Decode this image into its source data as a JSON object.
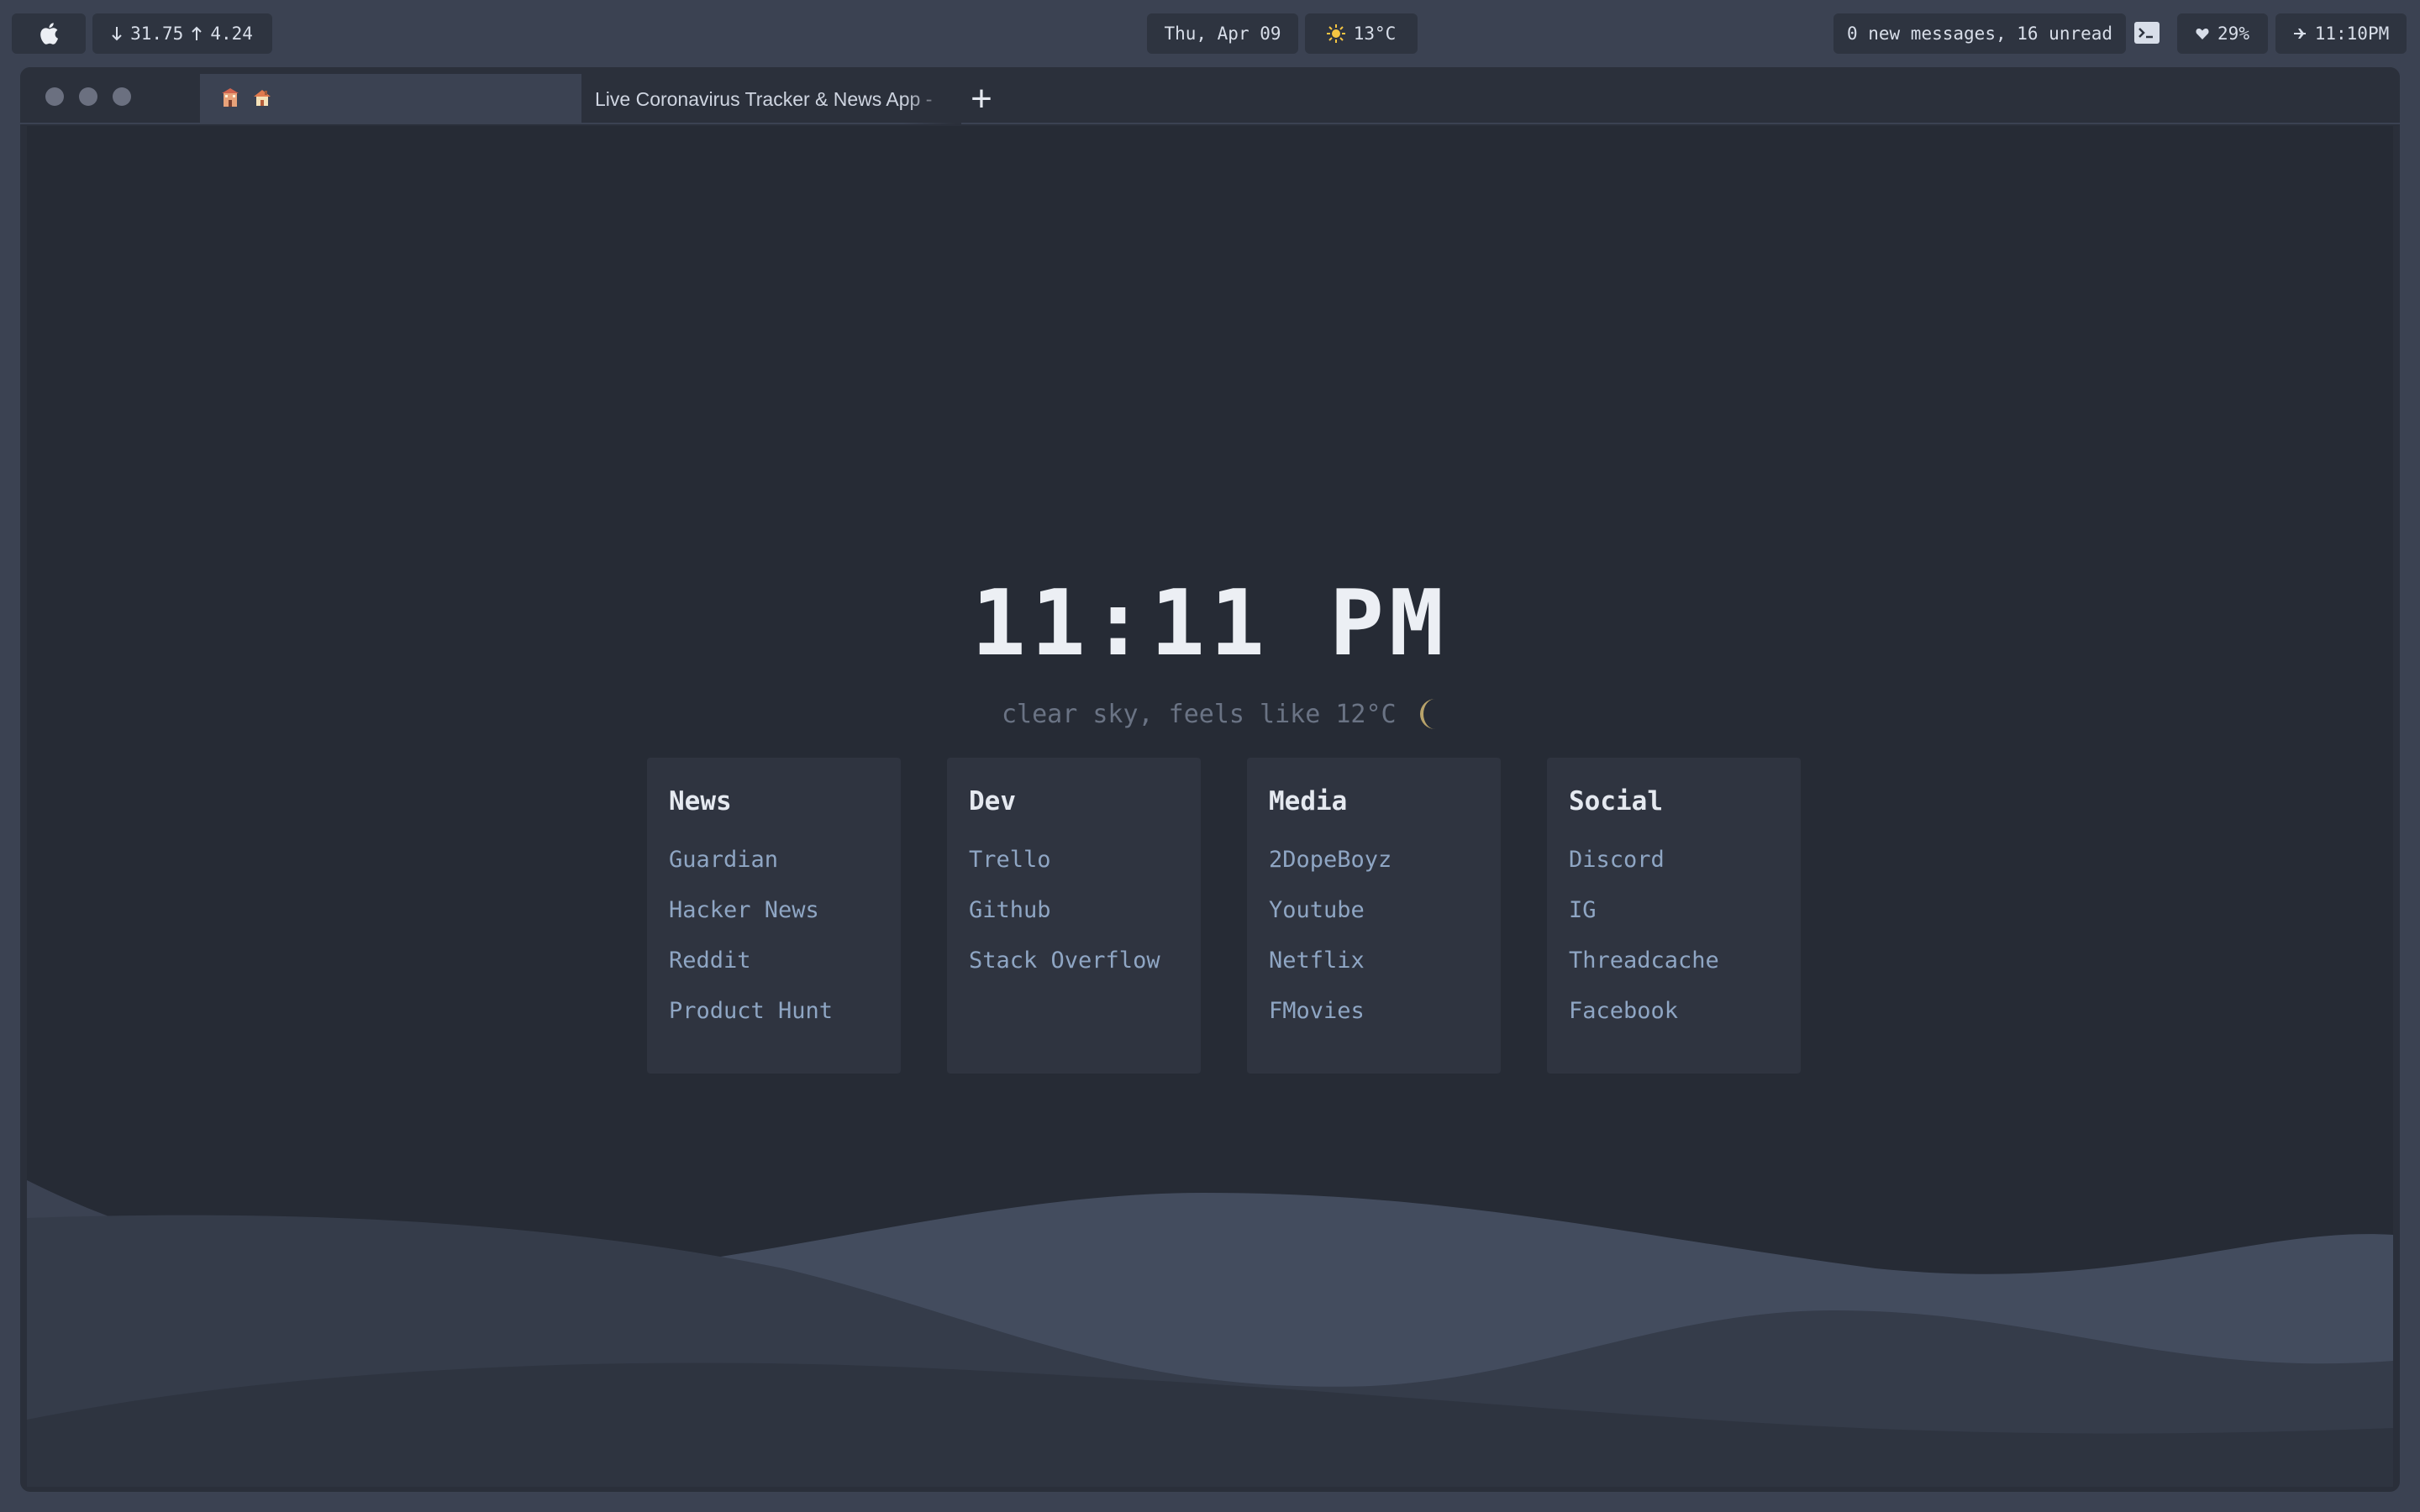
{
  "menubar": {
    "apple_icon": "apple-icon",
    "network": {
      "down_icon": "arrow-down-icon",
      "down": "31.75",
      "up_icon": "arrow-up-icon",
      "up": "4.24"
    },
    "date": "Thu, Apr 09",
    "weather": {
      "icon": "sun-icon",
      "temp": "13°C"
    },
    "mail": "0 new messages, 16 unread",
    "terminal_icon": "terminal-icon",
    "battery": {
      "icon": "heart-icon",
      "value": "29%"
    },
    "time": {
      "icon": "plane-icon",
      "value": "11:10PM"
    }
  },
  "browser": {
    "active_tab_icons": [
      "building-icon",
      "house-icon"
    ],
    "tab_title": "Live Coronavirus Tracker & News App -",
    "new_tab_label": "+"
  },
  "page": {
    "clock": "11:11 PM",
    "weather_text": "clear sky, feels like 12°C",
    "weather_icon": "moon-icon",
    "moon_color": "#b8a36a",
    "groups": [
      {
        "title": "News",
        "links": [
          "Guardian",
          "Hacker News",
          "Reddit",
          "Product Hunt"
        ]
      },
      {
        "title": "Dev",
        "links": [
          "Trello",
          "Github",
          "Stack Overflow"
        ]
      },
      {
        "title": "Media",
        "links": [
          "2DopeBoyz",
          "Youtube",
          "Netflix",
          "FMovies"
        ]
      },
      {
        "title": "Social",
        "links": [
          "Discord",
          "IG",
          "Threadcache",
          "Facebook"
        ]
      }
    ]
  },
  "colors": {
    "background": "#262b35",
    "card": "#2f3440",
    "link": "#8fa6c4",
    "heading": "#e5e9f0",
    "wave_back": "#3b4252",
    "wave_mid": "#434c5e",
    "wave_front": "#2e3440"
  }
}
